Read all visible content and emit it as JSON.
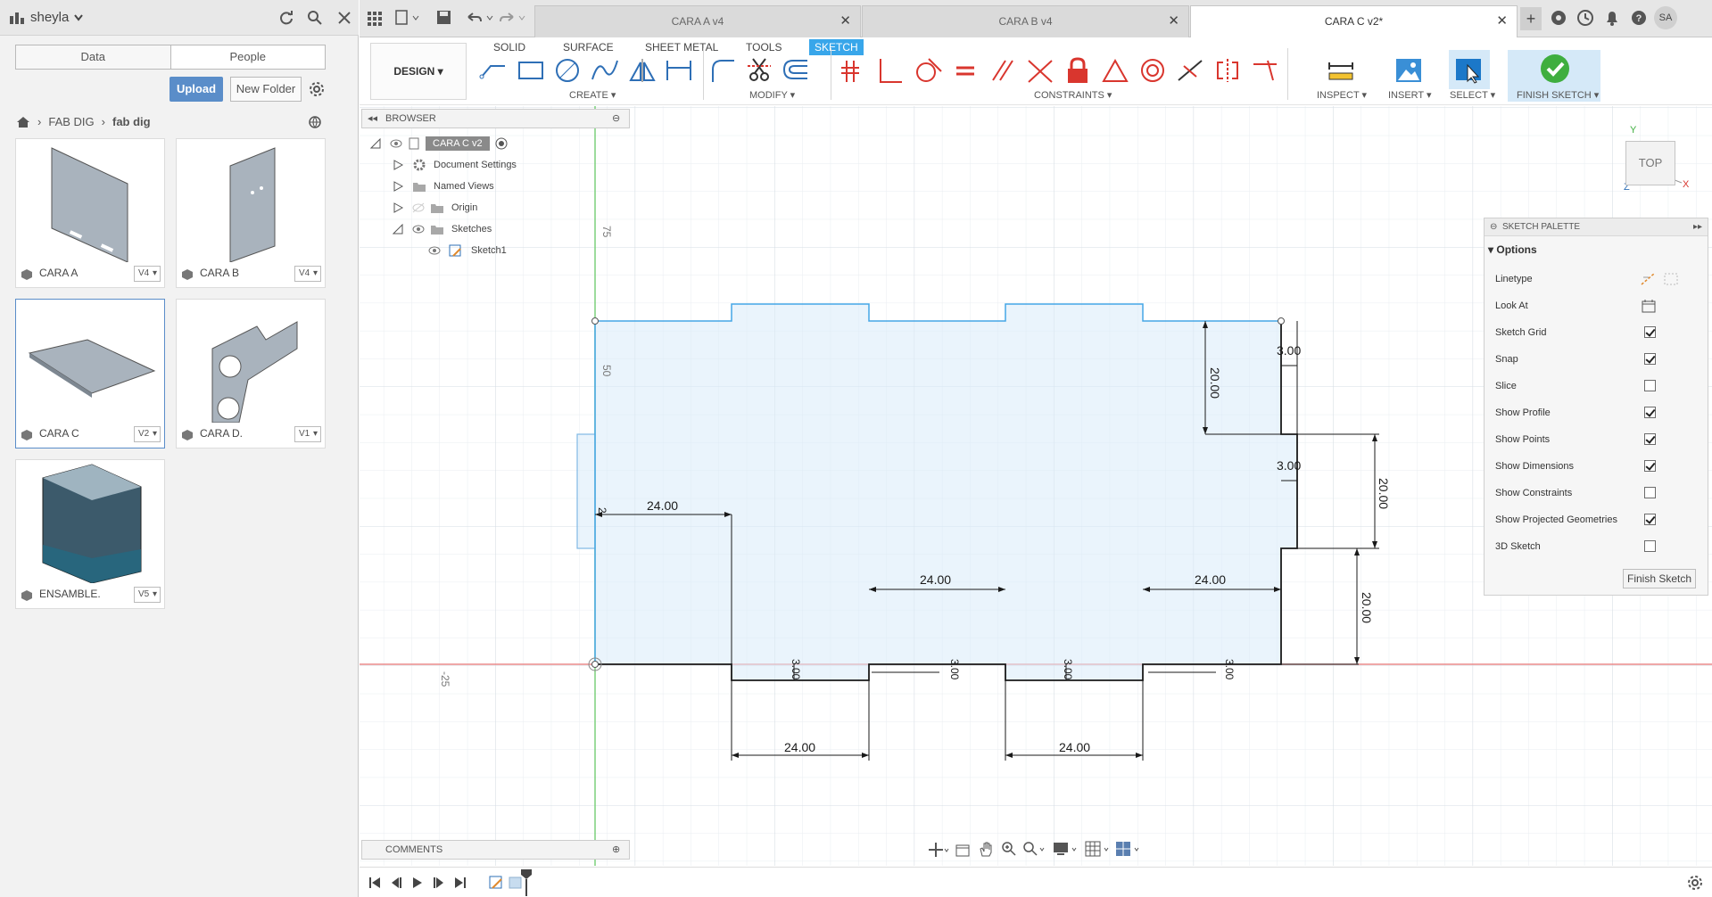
{
  "data_panel": {
    "user_name": "sheyla",
    "tabs": [
      "Data",
      "People"
    ],
    "upload_label": "Upload",
    "new_folder_label": "New Folder",
    "breadcrumb": [
      "FAB DIG",
      "fab dig"
    ],
    "files": [
      {
        "name": "CARA A",
        "version": "V4"
      },
      {
        "name": "CARA B",
        "version": "V4"
      },
      {
        "name": "CARA C",
        "version": "V2"
      },
      {
        "name": "CARA D.",
        "version": "V1"
      },
      {
        "name": "ENSAMBLE.",
        "version": "V5"
      }
    ]
  },
  "doc_tabs": [
    {
      "title": "CARA A v4",
      "active": false
    },
    {
      "title": "CARA B v4",
      "active": false
    },
    {
      "title": "CARA C v2*",
      "active": true
    }
  ],
  "header_right": {
    "avatar": "SA"
  },
  "toolbar": {
    "workspace": "DESIGN",
    "workspace_tabs": [
      "SOLID",
      "SURFACE",
      "SHEET METAL",
      "TOOLS",
      "SKETCH"
    ],
    "active_tab": "SKETCH",
    "groups": {
      "create": "CREATE",
      "modify": "MODIFY",
      "constraints": "CONSTRAINTS",
      "inspect": "INSPECT",
      "insert": "INSERT",
      "select": "SELECT",
      "finish": "FINISH SKETCH"
    },
    "accent_color": "#38a6ea",
    "constraint_color": "#d9362e"
  },
  "browser": {
    "title": "BROWSER",
    "root": "CARA C v2",
    "items": [
      "Document Settings",
      "Named Views",
      "Origin",
      "Sketches"
    ],
    "sketch": "Sketch1"
  },
  "canvas": {
    "axis_labels": [
      "75",
      "50",
      "-25"
    ],
    "dimensions": {
      "top_right_height": "20.00",
      "top_right_inset": "3.00",
      "mid_right_inset": "3.00",
      "right_tab_height": "20.00",
      "right_lower_height": "20.00",
      "left_tab_width": "24.00",
      "bottom_inner_left": "24.00",
      "bottom_inner_right": "24.00",
      "bottom_tab_left": "24.00",
      "bottom_tab_right": "24.00",
      "bottom_depth_1": "3.00",
      "bottom_depth_2": "3.00",
      "bottom_depth_3": "3.00",
      "bottom_depth_4": "3.00",
      "left_small": "2"
    },
    "viewcube_label": "TOP",
    "axis_x": "X",
    "axis_y": "Y",
    "axis_z": "Z"
  },
  "palette": {
    "title": "SKETCH PALETTE",
    "section": "Options",
    "rows": [
      {
        "label": "Linetype",
        "type": "icons"
      },
      {
        "label": "Look At",
        "type": "icon"
      },
      {
        "label": "Sketch Grid",
        "checked": true
      },
      {
        "label": "Snap",
        "checked": true
      },
      {
        "label": "Slice",
        "checked": false
      },
      {
        "label": "Show Profile",
        "checked": true
      },
      {
        "label": "Show Points",
        "checked": true
      },
      {
        "label": "Show Dimensions",
        "checked": true
      },
      {
        "label": "Show Constraints",
        "checked": false
      },
      {
        "label": "Show Projected Geometries",
        "checked": true
      },
      {
        "label": "3D Sketch",
        "checked": false
      }
    ],
    "finish_label": "Finish Sketch"
  },
  "comments_label": "COMMENTS"
}
